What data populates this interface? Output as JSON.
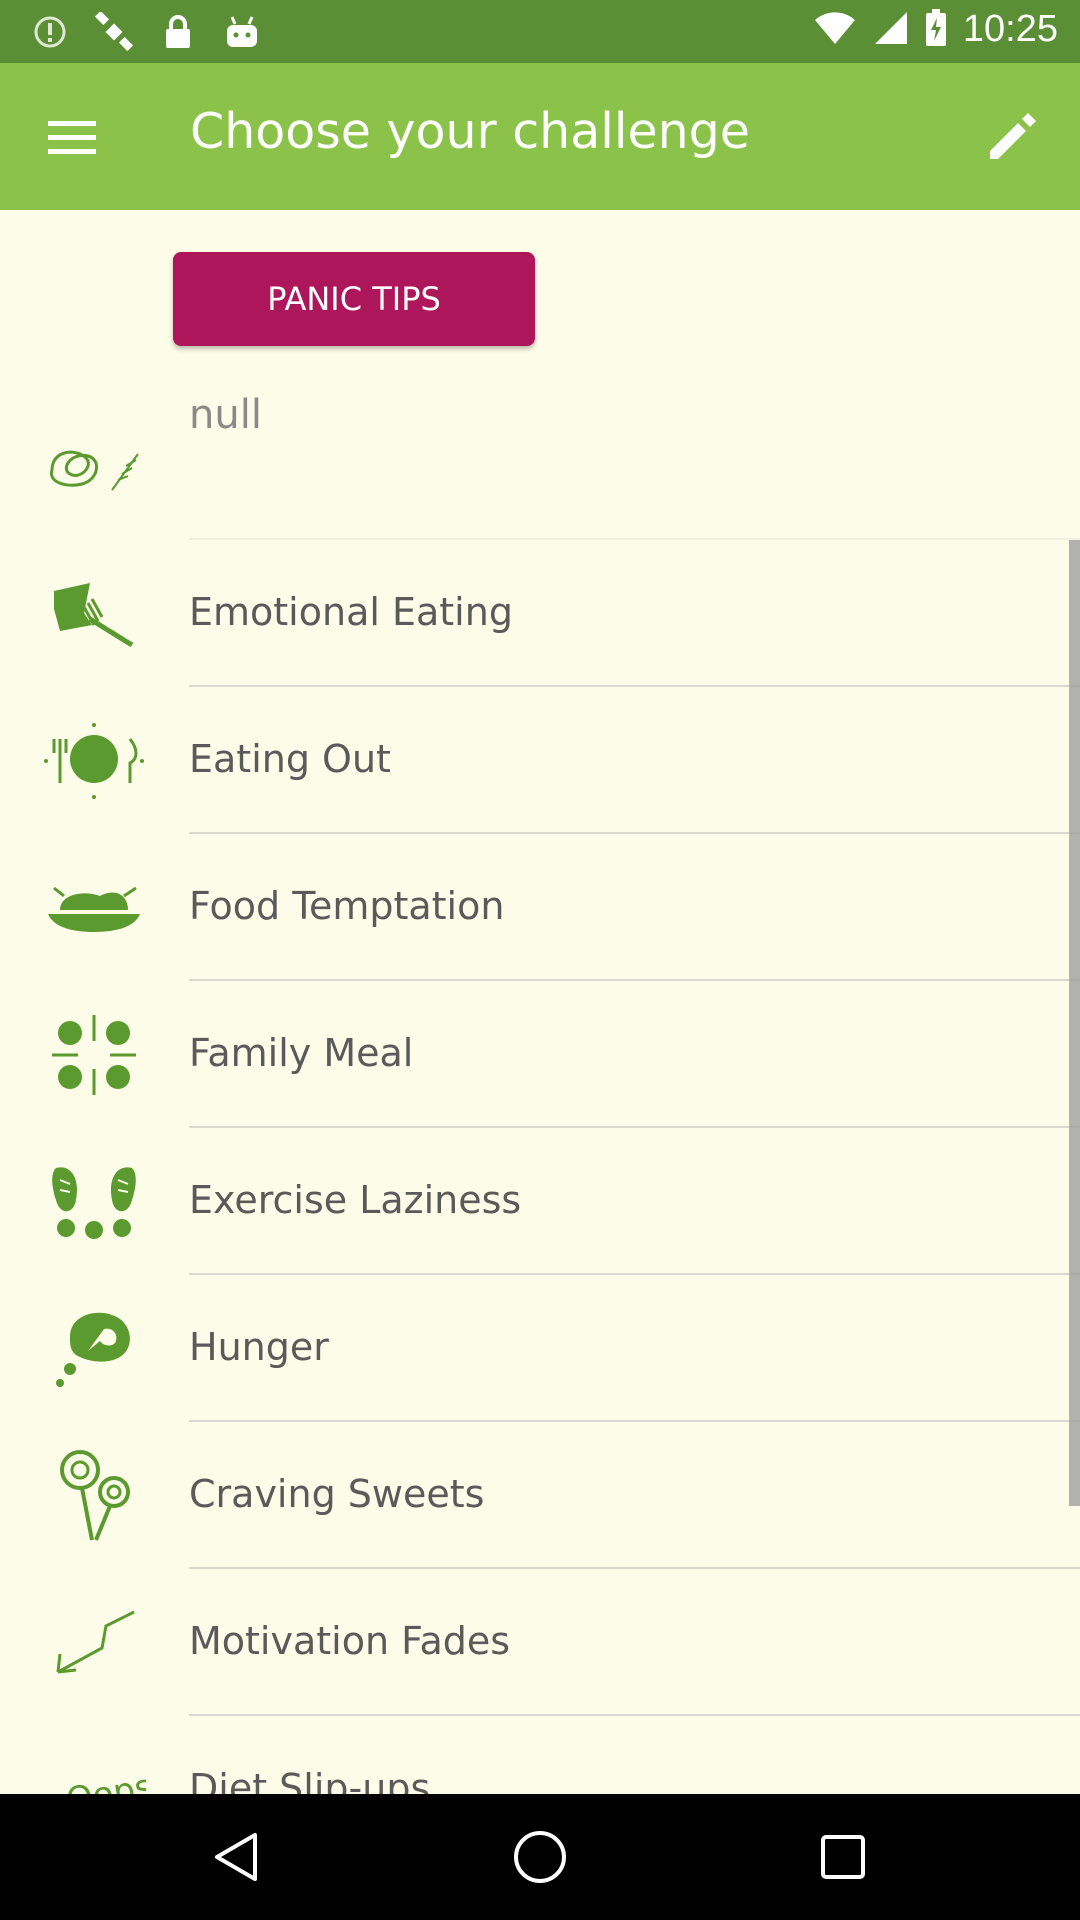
{
  "status_bar": {
    "time": "10:25",
    "icons": [
      "circle-alert-icon",
      "fake-gps-icon",
      "lock-icon",
      "android-icon",
      "wifi-icon",
      "signal-icon",
      "battery-icon"
    ]
  },
  "app_bar": {
    "title": "Choose your challenge",
    "menu_icon": "menu-icon",
    "edit_icon": "edit-pencil-icon"
  },
  "panic_button": {
    "label": "PANIC TIPS"
  },
  "list": {
    "header": {
      "label": "null",
      "icon": "pretzel-icon"
    },
    "items": [
      {
        "label": "Emotional Eating",
        "icon": "emotional-eating-icon"
      },
      {
        "label": "Eating Out",
        "icon": "eating-out-icon"
      },
      {
        "label": "Food Temptation",
        "icon": "food-temptation-icon"
      },
      {
        "label": "Family Meal",
        "icon": "family-meal-icon"
      },
      {
        "label": "Exercise Laziness",
        "icon": "footprints-icon"
      },
      {
        "label": "Hunger",
        "icon": "hunger-icon"
      },
      {
        "label": "Craving Sweets",
        "icon": "lollipop-icon"
      },
      {
        "label": "Motivation Fades",
        "icon": "falling-arrow-icon"
      },
      {
        "label": "Diet Slip-ups",
        "icon": "oops-icon"
      }
    ]
  },
  "colors": {
    "status_bar": "#5a8f35",
    "app_bar": "#8bc34a",
    "panic_button": "#ad165a",
    "background": "#fdfce8",
    "icon_green": "#5a9a2e"
  },
  "nav_bar": {
    "back": "back-icon",
    "home": "home-icon",
    "recents": "recents-icon"
  }
}
